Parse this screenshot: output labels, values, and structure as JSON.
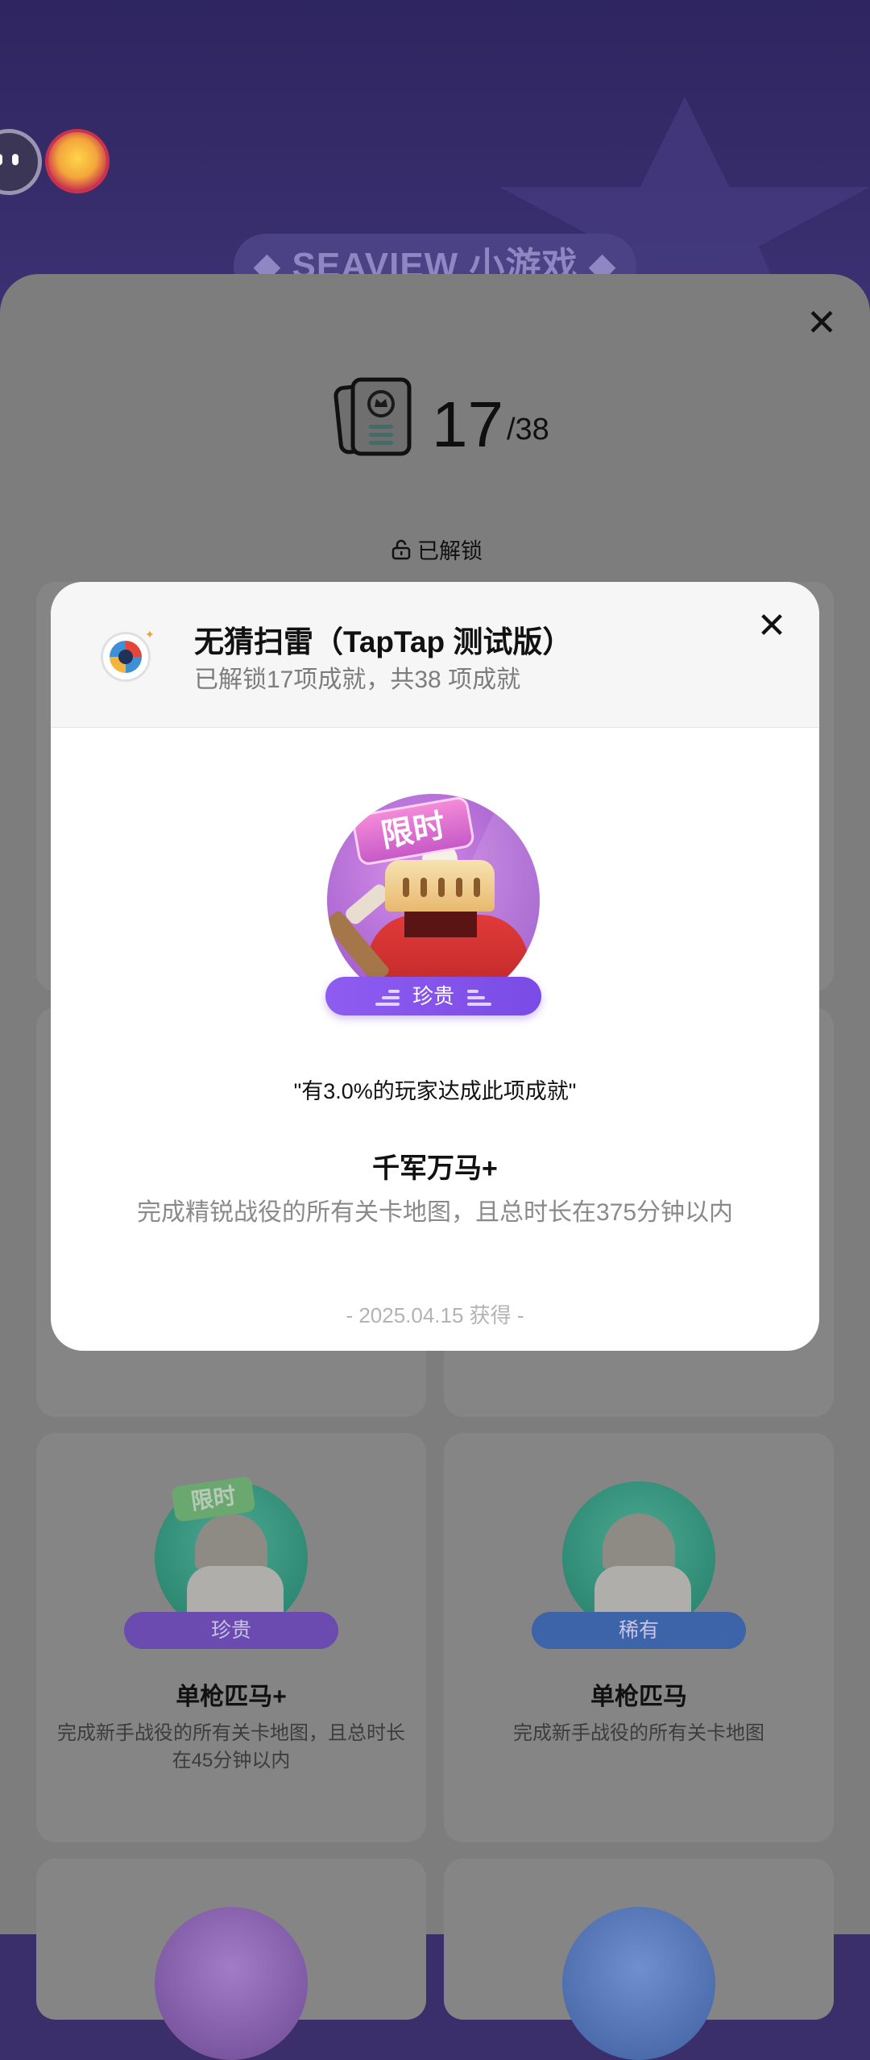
{
  "hero": {
    "banner_text": "◆ SEAVIEW 小游戏 ◆"
  },
  "sheet": {
    "count_unlocked": "17",
    "count_total": "/38",
    "unlocked_label": "已解锁"
  },
  "cards": [
    {
      "rarity": "珍贵",
      "rarity_color": "#6c4bb0",
      "limited_tag": "限时",
      "title": "单枪匹马+",
      "desc": "完成新手战役的所有关卡地图，且总时长在45分钟以内"
    },
    {
      "rarity": "稀有",
      "rarity_color": "#3d63a8",
      "title": "单枪匹马",
      "desc": "完成新手战役的所有关卡地图"
    }
  ],
  "modal": {
    "game_title": "无猜扫雷（TapTap 测试版）",
    "game_subtitle": "已解锁17项成就，共38 项成就",
    "badge_tag": "限时",
    "rarity": "珍贵",
    "percent_text": "\"有3.0%的玩家达成此项成就\"",
    "achievement_name": "千军万马+",
    "achievement_desc": "完成精锐战役的所有关卡地图，且总时长在375分钟以内",
    "achieved_date": "- 2025.04.15 获得 -"
  },
  "icons": {
    "close": "close-icon",
    "lock_open": "unlock-icon",
    "achievement_book": "achievement-book-icon"
  },
  "colors": {
    "header_bg": "#2e2560",
    "rarity_precious": "#8e5cf0",
    "rarity_rare": "#3d63a8",
    "sheet_overlay": "#7d7d7d"
  }
}
